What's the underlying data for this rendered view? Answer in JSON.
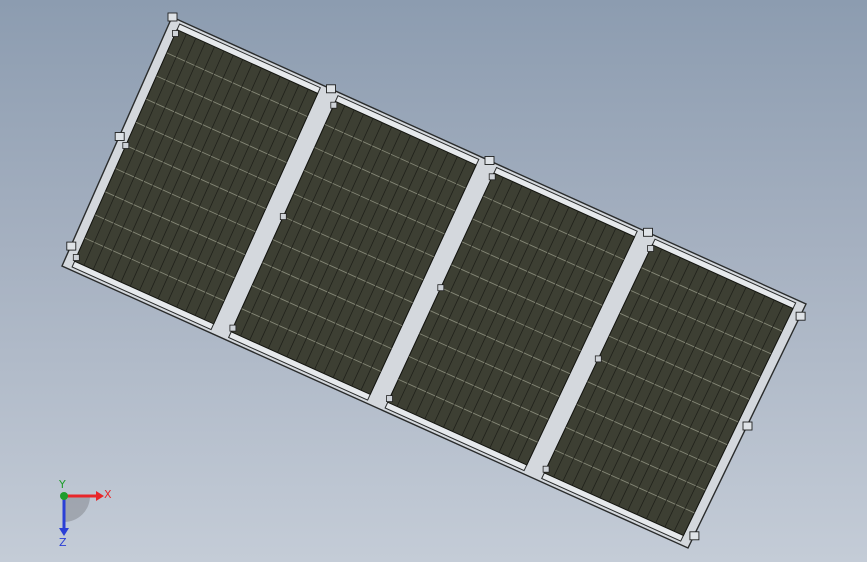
{
  "viewport": {
    "background_top": "#8c9cb0",
    "background_bottom": "#c4ccd7"
  },
  "model": {
    "panel_count": 4,
    "cell_rows": 10,
    "cell_columns": 15,
    "cell_color": "#3d3f33",
    "cell_line_color": "#1e1f19",
    "frame_color": "#d4d8dd",
    "frame_edge_color": "#2a2c2c"
  },
  "triad": {
    "x_label": "X",
    "y_label": "Y",
    "z_label": "Z",
    "x_color": "#e8262a",
    "y_color": "#1f9d2c",
    "z_color": "#2b3fd6"
  }
}
